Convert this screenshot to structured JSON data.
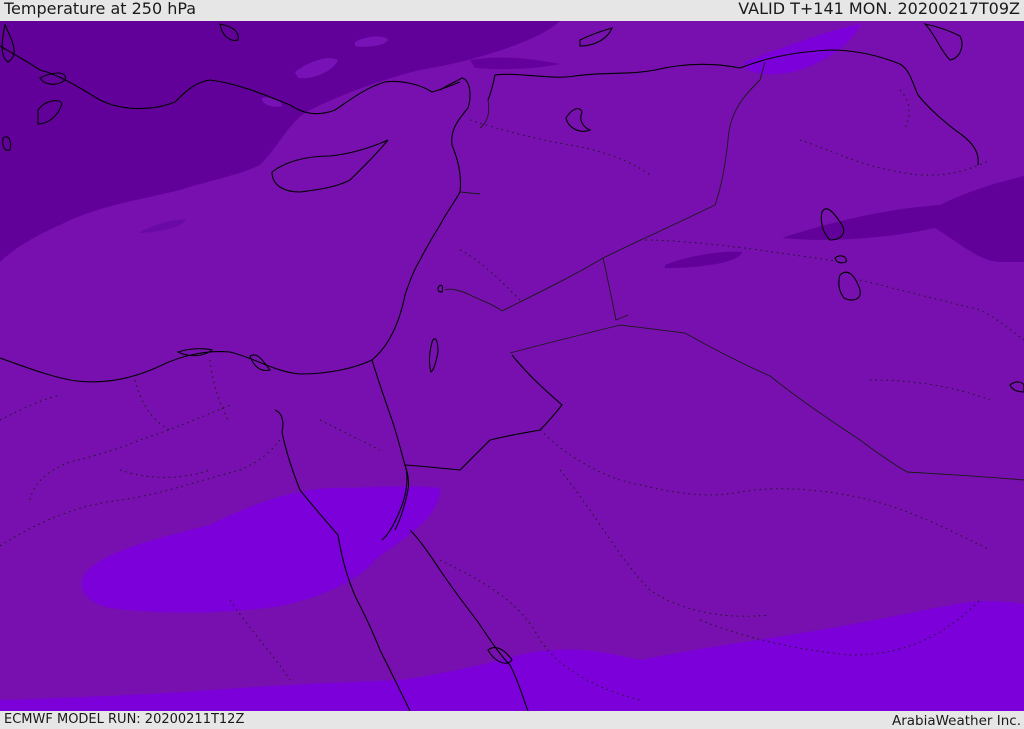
{
  "header": {
    "title": "Temperature at 250 hPa",
    "valid_time": "VALID T+141 MON. 20200217T09Z"
  },
  "footer": {
    "model_run": "ECMWF MODEL RUN: 20200211T12Z",
    "credit": "ArabiaWeather Inc."
  },
  "colors": {
    "base_field": "#7810b0",
    "cold_band": "#62009a",
    "warm_band": "#7c00da",
    "coast_line": "#000000",
    "border_line": "#1a1a1a",
    "chrome_bg": "#e6e6e6"
  }
}
